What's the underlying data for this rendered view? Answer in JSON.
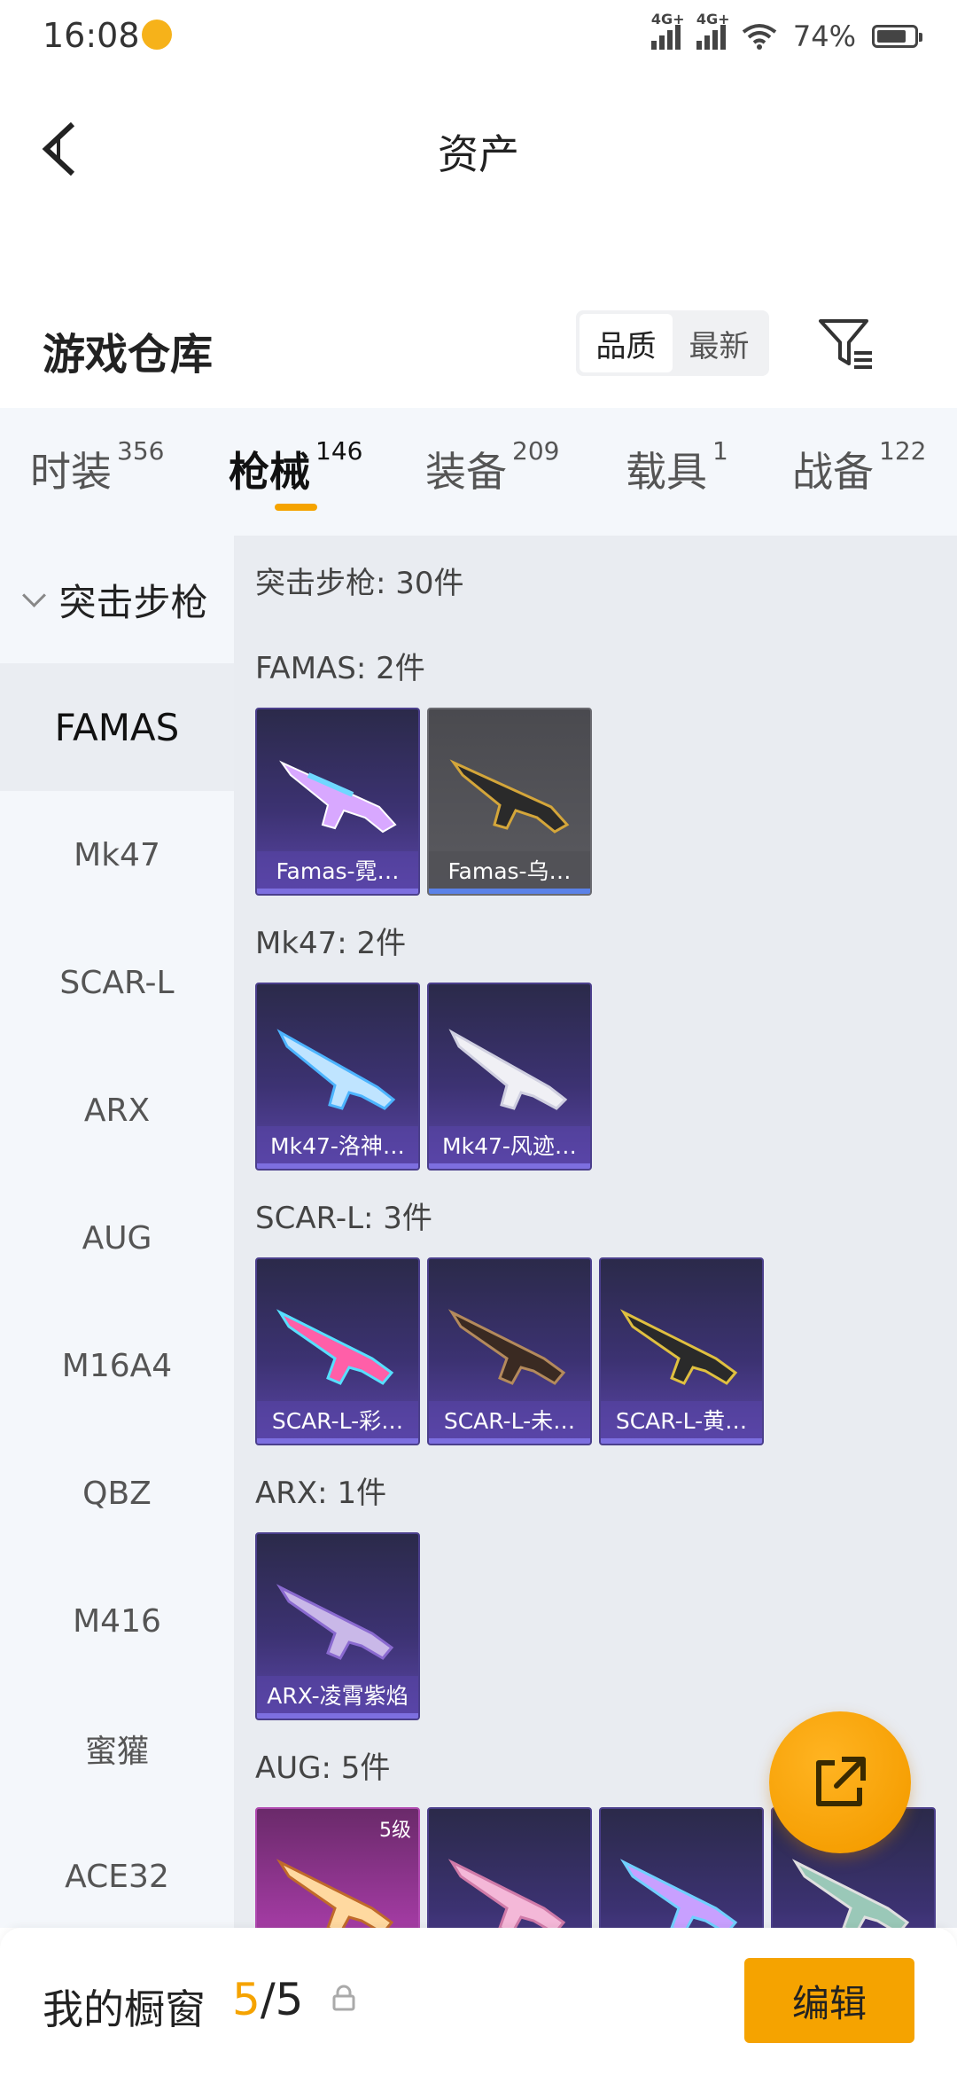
{
  "status_bar": {
    "time": "16:08",
    "signal1": "4G+",
    "signal2": "4G+",
    "battery": "74%"
  },
  "header": {
    "title": "资产"
  },
  "warehouse": {
    "title": "游戏仓库",
    "sort_options": [
      "品质",
      "最新"
    ],
    "sort_selected": "品质"
  },
  "tabs": [
    {
      "label": "时装",
      "count": "356"
    },
    {
      "label": "枪械",
      "count": "146"
    },
    {
      "label": "装备",
      "count": "209"
    },
    {
      "label": "载具",
      "count": "1"
    },
    {
      "label": "战备",
      "count": "122"
    }
  ],
  "active_tab": "枪械",
  "category": {
    "title": "突击步枪",
    "items": [
      "FAMAS",
      "Mk47",
      "SCAR-L",
      "ARX",
      "AUG",
      "M16A4",
      "QBZ",
      "M416",
      "蜜獾",
      "ACE32"
    ],
    "selected": "FAMAS"
  },
  "content": {
    "total": "突击步枪: 30件",
    "groups": [
      {
        "label": "FAMAS: 2件",
        "items": [
          "Famas-霓…",
          "Famas-乌…"
        ]
      },
      {
        "label": "Mk47: 2件",
        "items": [
          "Mk47-洛神…",
          "Mk47-风迹…"
        ]
      },
      {
        "label": "SCAR-L: 3件",
        "items": [
          "SCAR-L-彩…",
          "SCAR-L-未…",
          "SCAR-L-黄…"
        ]
      },
      {
        "label": "ARX: 1件",
        "items": [
          "ARX-凌霄紫焰"
        ]
      },
      {
        "label": "AUG: 5件",
        "level_badge": "5级"
      }
    ]
  },
  "bottom_bar": {
    "label": "我的橱窗",
    "count_current": "5",
    "count_sep": "/",
    "count_total": "5",
    "edit_label": "编辑"
  },
  "colors": {
    "accent": "#f5a300",
    "card_purple": "#3c3272"
  }
}
